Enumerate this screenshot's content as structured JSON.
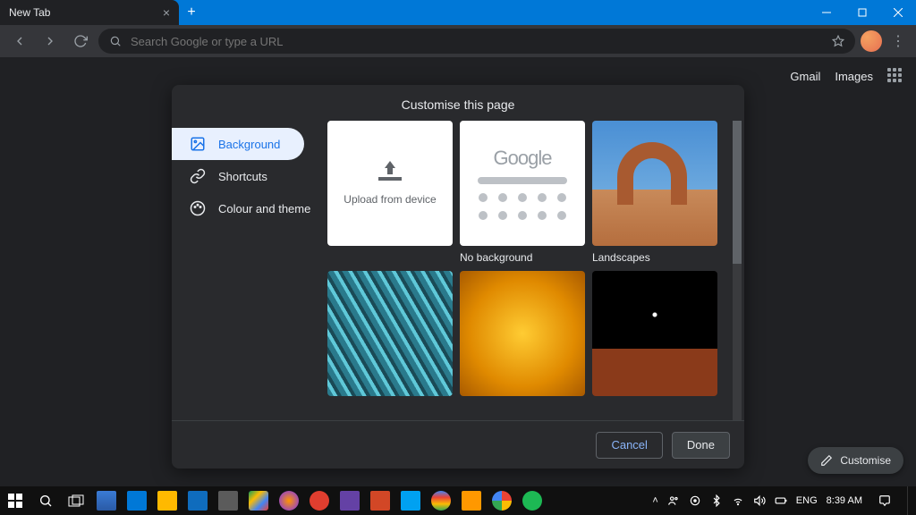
{
  "titlebar": {
    "tab_title": "New Tab"
  },
  "toolbar": {
    "omnibox_placeholder": "Search Google or type a URL"
  },
  "ntp": {
    "gmail": "Gmail",
    "images": "Images"
  },
  "dialog": {
    "title": "Customise this page",
    "sidebar": {
      "background": "Background",
      "shortcuts": "Shortcuts",
      "color_theme": "Colour and theme"
    },
    "tiles": {
      "upload": "Upload from device",
      "no_background": "No background",
      "landscapes": "Landscapes"
    },
    "footer": {
      "cancel": "Cancel",
      "done": "Done"
    }
  },
  "customise_chip": "Customise",
  "taskbar": {
    "lang": "ENG",
    "time": "8:39 AM"
  }
}
